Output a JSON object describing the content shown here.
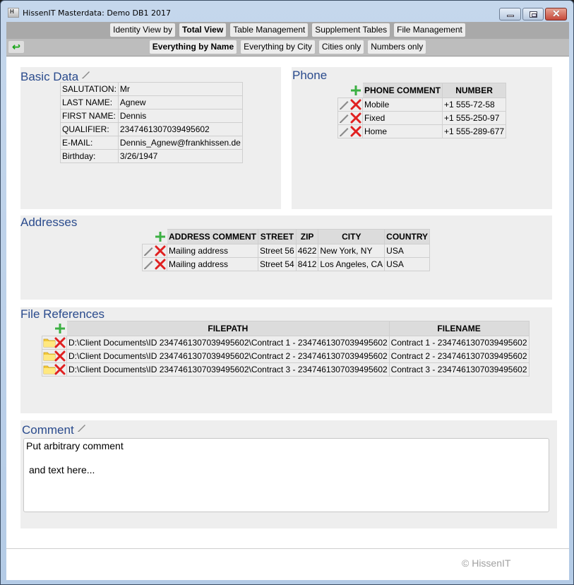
{
  "window": {
    "title": "HissenIT Masterdata: Demo DB1 2017",
    "app_icon_letter": "H",
    "controls": {
      "minimize": "minimize",
      "maximize": "maximize",
      "close": "✕"
    }
  },
  "nav_primary": [
    {
      "label": "Identity View by",
      "active": false
    },
    {
      "label": "Total View",
      "active": true
    },
    {
      "label": "Table Management",
      "active": false
    },
    {
      "label": "Supplement Tables",
      "active": false
    },
    {
      "label": "File Management",
      "active": false
    }
  ],
  "nav_secondary": [
    {
      "label": "Everything by Name",
      "active": true
    },
    {
      "label": "Everything by City",
      "active": false
    },
    {
      "label": "Cities only",
      "active": false
    },
    {
      "label": "Numbers only",
      "active": false
    }
  ],
  "back_button": {
    "icon": "back-arrow-icon",
    "glyph": "↩"
  },
  "basic_data": {
    "title": "Basic Data",
    "rows": [
      {
        "label": "SALUTATION:",
        "value": "Mr"
      },
      {
        "label": "LAST NAME:",
        "value": "Agnew"
      },
      {
        "label": "FIRST NAME:",
        "value": "Dennis"
      },
      {
        "label": "QUALIFIER:",
        "value": "2347461307039495602"
      },
      {
        "label": "E-MAIL:",
        "value": "Dennis_Agnew@frankhissen.de"
      },
      {
        "label": "Birthday:",
        "value": "3/26/1947"
      }
    ]
  },
  "phone": {
    "title": "Phone",
    "columns": [
      "PHONE COMMENT",
      "NUMBER"
    ],
    "rows": [
      {
        "comment": "Mobile",
        "number": "+1 555-72-58"
      },
      {
        "comment": "Fixed",
        "number": "+1 555-250-97"
      },
      {
        "comment": "Home",
        "number": "+1 555-289-677"
      }
    ]
  },
  "addresses": {
    "title": "Addresses",
    "columns": [
      "ADDRESS COMMENT",
      "STREET",
      "ZIP",
      "CITY",
      "COUNTRY"
    ],
    "rows": [
      {
        "comment": "Mailing address",
        "street": "Street 56",
        "zip": "4622",
        "city": "New York, NY",
        "country": "USA"
      },
      {
        "comment": "Mailing address",
        "street": "Street 54",
        "zip": "8412",
        "city": "Los Angeles, CA",
        "country": "USA"
      }
    ]
  },
  "file_references": {
    "title": "File References",
    "columns": [
      "FILEPATH",
      "FILENAME"
    ],
    "rows": [
      {
        "filepath": "D:\\Client Documents\\ID 2347461307039495602\\Contract 1 - 2347461307039495602",
        "filename": "Contract 1 - 2347461307039495602"
      },
      {
        "filepath": "D:\\Client Documents\\ID 2347461307039495602\\Contract 2 - 2347461307039495602",
        "filename": "Contract 2 - 2347461307039495602"
      },
      {
        "filepath": "D:\\Client Documents\\ID 2347461307039495602\\Contract 3 - 2347461307039495602",
        "filename": "Contract 3 - 2347461307039495602"
      }
    ]
  },
  "comment": {
    "title": "Comment",
    "line1": "Put arbitrary comment",
    "line2": "and text here..."
  },
  "footer": {
    "copyright": "© HissenIT"
  },
  "colors": {
    "heading": "#2a4b8d",
    "add": "#3cb043",
    "delete": "#e02020",
    "panel": "#eeeeee"
  }
}
